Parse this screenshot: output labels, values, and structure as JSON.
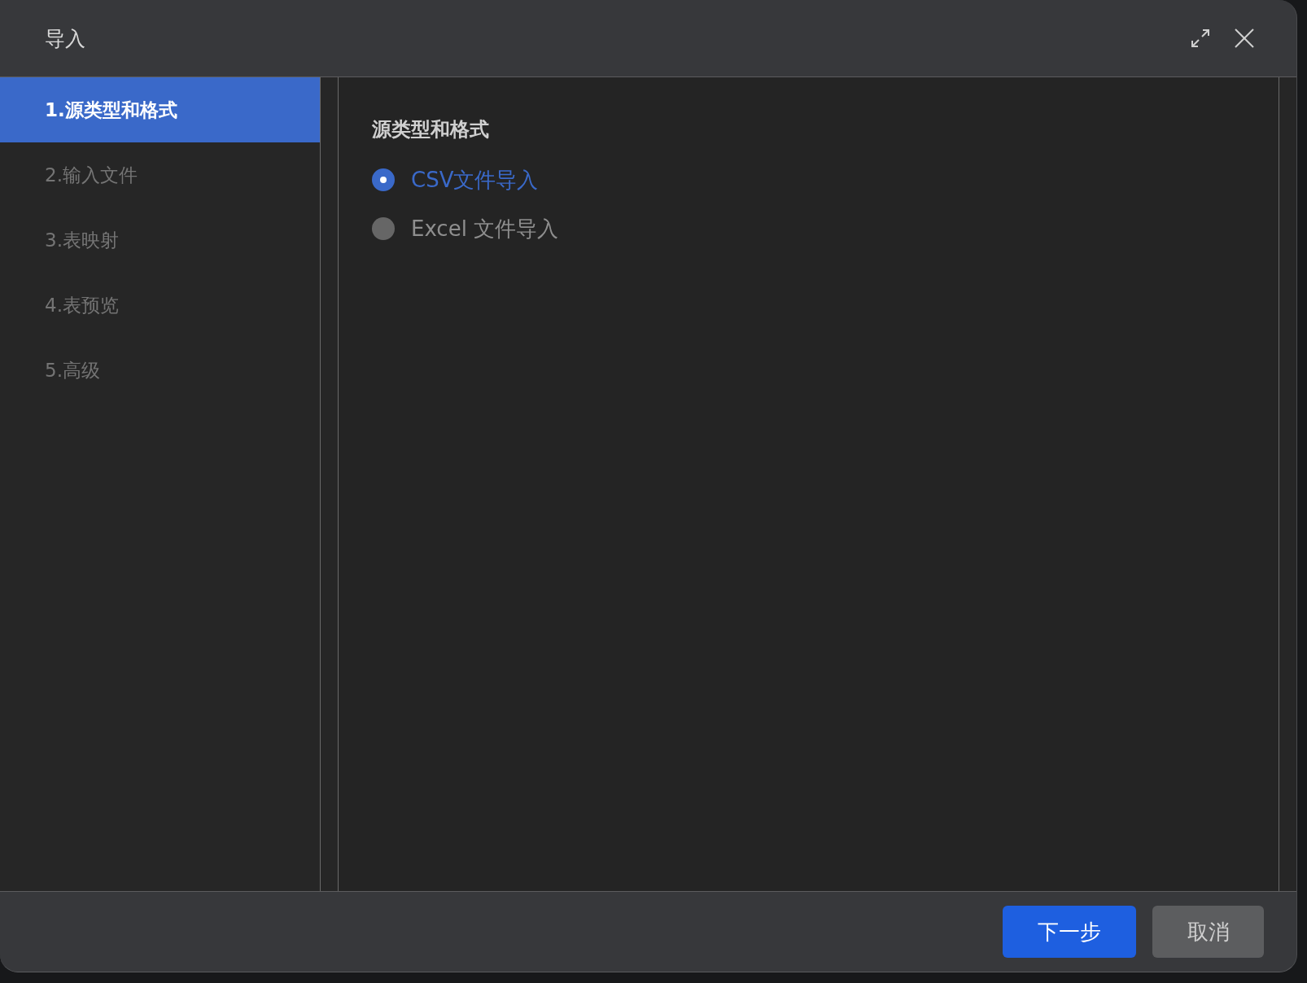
{
  "window": {
    "title": "导入"
  },
  "sidebar": {
    "items": [
      {
        "label": "1.源类型和格式",
        "selected": true
      },
      {
        "label": "2.输入文件",
        "selected": false
      },
      {
        "label": "3.表映射",
        "selected": false
      },
      {
        "label": "4.表预览",
        "selected": false
      },
      {
        "label": "5.高级",
        "selected": false
      }
    ]
  },
  "content": {
    "heading": "源类型和格式",
    "options": [
      {
        "label": "CSV文件导入",
        "selected": true
      },
      {
        "label": "Excel 文件导入",
        "selected": false
      }
    ]
  },
  "buttons": [
    {
      "label": "下一步",
      "kind": "primary"
    },
    {
      "label": "取消",
      "kind": "secondary"
    }
  ]
}
